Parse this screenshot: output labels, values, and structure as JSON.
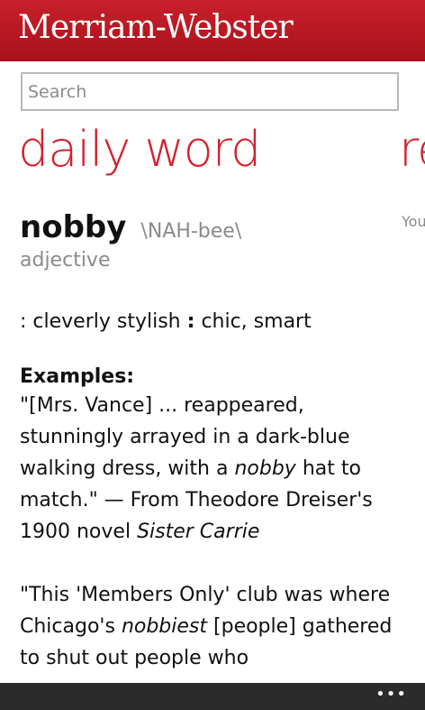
{
  "header": {
    "brand": "Merriam-Webster"
  },
  "search": {
    "placeholder": "Search",
    "value": ""
  },
  "pivot": {
    "current": "daily word",
    "next_peek": "re",
    "next_peek_text": "You"
  },
  "word": {
    "term": "nobby",
    "pronunciation": "\\NAH-bee\\",
    "part_of_speech": "adjective",
    "definition_part1": ": cleverly stylish",
    "definition_sep": ":",
    "definition_part2": "chic, smart",
    "examples_heading": "Examples:",
    "example1": {
      "a": "\"[Mrs. Vance] ... reappeared, stunningly arrayed in a dark-blue walking dress, with a",
      "b": "nobby",
      "c": "hat to match.\" — From Theodore Dreiser's 1900 novel",
      "d": "Sister Carrie"
    },
    "example2": {
      "a": "\"This 'Members Only' club was where Chicago's",
      "b": "nobbiest",
      "c": "[people] gathered to shut out people who"
    }
  },
  "appbar": {
    "more": "•••"
  },
  "colors": {
    "brand_red": "#c8202b",
    "accent_red": "#d4212e",
    "appbar": "#2b2b2b"
  }
}
